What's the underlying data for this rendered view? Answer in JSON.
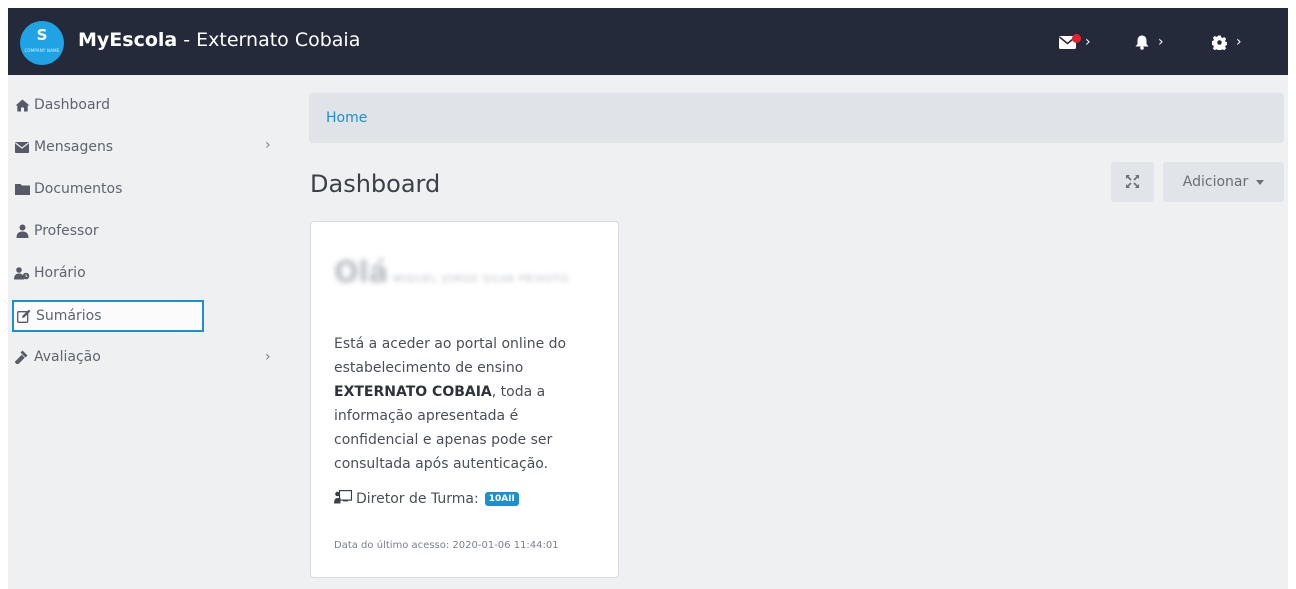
{
  "app": {
    "logo_letter": "S",
    "logo_caption": "COMPANY NAME",
    "brand": "MyEscola",
    "school": " - Externato Cobaia"
  },
  "topbar": {
    "icons": [
      "envelope-icon",
      "bell-icon",
      "gear-icon"
    ],
    "chevron": "›",
    "mail_has_notification": true
  },
  "sidebar": {
    "items": [
      {
        "label": "Dashboard",
        "icon": "home-icon",
        "has_submenu": false
      },
      {
        "label": "Mensagens",
        "icon": "envelope-icon",
        "has_submenu": true
      },
      {
        "label": "Documentos",
        "icon": "folder-icon",
        "has_submenu": false
      },
      {
        "label": "Professor",
        "icon": "teacher-icon",
        "has_submenu": false
      },
      {
        "label": "Horário",
        "icon": "users-clock-icon",
        "has_submenu": false
      },
      {
        "label": "Sumários",
        "icon": "edit-icon",
        "has_submenu": false,
        "selected": true
      },
      {
        "label": "Avaliação",
        "icon": "gavel-icon",
        "has_submenu": true
      }
    ],
    "chevron": "›"
  },
  "breadcrumb": {
    "home": "Home"
  },
  "page": {
    "title": "Dashboard"
  },
  "toolbar": {
    "add_label": "Adicionar"
  },
  "card": {
    "greeting": "Olá",
    "name": "MIGUEL JORGE SILVA PEIXOTO",
    "text_before": "Está a aceder ao portal online do estabelecimento de ensino ",
    "school_bold": "EXTERNATO COBAIA",
    "text_after": ", toda a informação apresentada é confidencial e apenas pode ser consultada após autenticação.",
    "director_label": "Diretor de Turma:",
    "turma": "10AII",
    "last_access": "Data do último acesso: 2020-01-06 11:44:01"
  },
  "colors": {
    "topbar": "#252a3a",
    "accent": "#1d8fce",
    "logo": "#1fa3e4",
    "notification": "#e8232e",
    "background": "#eef0f2"
  }
}
